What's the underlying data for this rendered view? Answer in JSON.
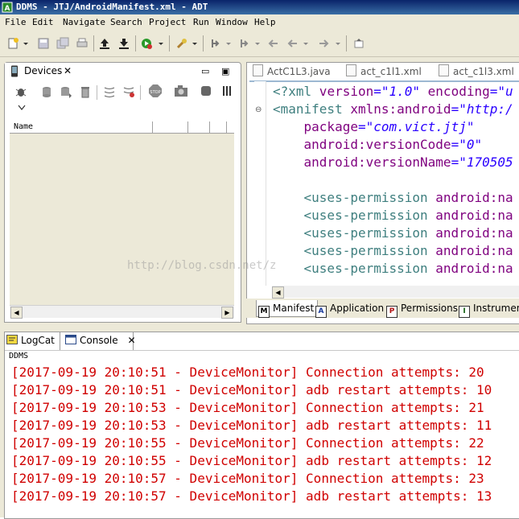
{
  "window": {
    "title": "DDMS - JTJ/AndroidManifest.xml - ADT"
  },
  "menu": [
    "File",
    "Edit",
    "Navigate",
    "Search",
    "Project",
    "Run",
    "Window",
    "Help"
  ],
  "devices": {
    "tab_label": "Devices",
    "columns": [
      "Name",
      "",
      "",
      "",
      ""
    ]
  },
  "editor": {
    "tabs": [
      "ActC1L3.java",
      "act_c1l1.xml",
      "act_c1l3.xml"
    ],
    "code": {
      "l1": [
        "<?xml",
        " version",
        "=\"1.0\"",
        " encoding",
        "=\"u"
      ],
      "l2": [
        "<manifest",
        " xmlns:android",
        "=\"http:/"
      ],
      "l3": [
        "    package",
        "=\"com.vict.jtj\""
      ],
      "l4": [
        "    android:versionCode",
        "=\"0\""
      ],
      "l5": [
        "    android:versionName",
        "=\"170505"
      ],
      "perm_tag": "    <uses-permission",
      "perm_attr": " android:na"
    },
    "bottom_tabs": [
      {
        "icon": "M",
        "label": "Manifest"
      },
      {
        "icon": "A",
        "label": "Application"
      },
      {
        "icon": "P",
        "label": "Permissions"
      },
      {
        "icon": "I",
        "label": "Instrument"
      }
    ]
  },
  "console": {
    "tabs": [
      "LogCat",
      "Console"
    ],
    "name": "DDMS",
    "lines": [
      "[2017-09-19 20:10:51 - DeviceMonitor] Connection attempts: 20",
      "[2017-09-19 20:10:51 - DeviceMonitor] adb restart attempts: 10",
      "[2017-09-19 20:10:53 - DeviceMonitor] Connection attempts: 21",
      "[2017-09-19 20:10:53 - DeviceMonitor] adb restart attempts: 11",
      "[2017-09-19 20:10:55 - DeviceMonitor] Connection attempts: 22",
      "[2017-09-19 20:10:55 - DeviceMonitor] adb restart attempts: 12",
      "[2017-09-19 20:10:57 - DeviceMonitor] Connection attempts: 23",
      "[2017-09-19 20:10:57 - DeviceMonitor] adb restart attempts: 13"
    ]
  },
  "watermark": "http://blog.csdn.net/z",
  "colors": {
    "error_text": "#d00000",
    "title_bar": "#0a246a",
    "chrome": "#ece9d8"
  },
  "icons": [
    "new-icon",
    "save-icon",
    "save-all-icon",
    "print-icon",
    "upload-icon",
    "download-icon",
    "run-icon",
    "search-icon",
    "back-icon",
    "forward-icon",
    "pin-icon",
    "debug-icon",
    "stop-icon",
    "screenshot-icon"
  ]
}
